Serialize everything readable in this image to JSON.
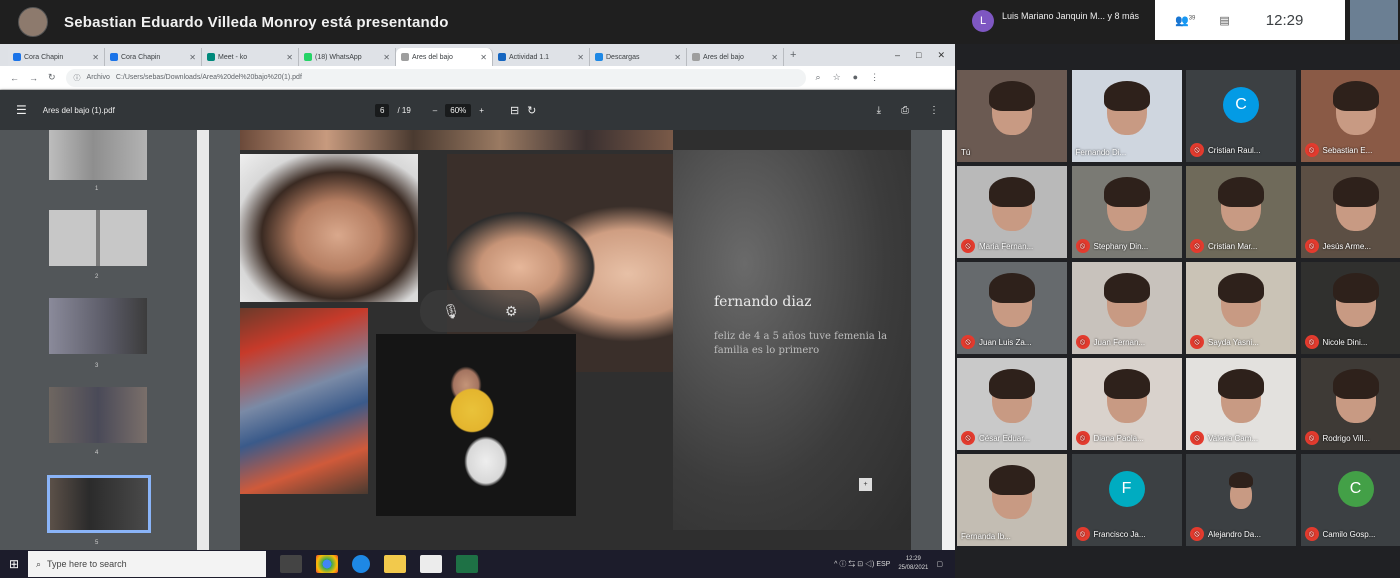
{
  "presenting": {
    "text": "Sebastian Eduardo Villeda Monroy está presentando"
  },
  "browser": {
    "tabs": [
      {
        "label": "Cora Chapin",
        "color": "#1a73e8"
      },
      {
        "label": "Cora Chapin",
        "color": "#1a73e8"
      },
      {
        "label": "Meet - ko",
        "color": "#00897b"
      },
      {
        "label": "(18) WhatsApp",
        "color": "#25d366"
      },
      {
        "label": "Ares del bajo",
        "color": "#9e9e9e",
        "active": true
      },
      {
        "label": "Actividad 1.1",
        "color": "#1565c0"
      },
      {
        "label": "Descargas",
        "color": "#1e88e5"
      },
      {
        "label": "Ares del bajo",
        "color": "#9e9e9e"
      }
    ],
    "new_tab": "+",
    "window_controls": [
      "–",
      "□",
      "✕"
    ],
    "url_protocol": "Archivo",
    "url": "C:/Users/sebas/Downloads/Area%20del%20bajo%20(1).pdf",
    "addr_icons": [
      "⌕",
      "☆",
      "●",
      "⋮"
    ]
  },
  "pdf": {
    "menu": "☰",
    "title": "Ares del bajo (1).pdf",
    "page": "6",
    "page_total": "/ 19",
    "zoom": "60%",
    "zoom_minus": "–",
    "zoom_plus": "+",
    "fit": "⊟",
    "rotate": "↻",
    "download": "⤓",
    "print": "⎙",
    "more": "⋮",
    "thumb_numbers": [
      "1",
      "2",
      "3",
      "4",
      "5"
    ],
    "slide": {
      "name": "fernando diaz",
      "desc": "feliz de 4 a 5 años tuve femenia la familia es lo primero",
      "box": "+"
    },
    "overlay": {
      "mic": "🎙",
      "settings": "⚙"
    }
  },
  "taskbar": {
    "start": "⊞",
    "search_icon": "⌕",
    "search_placeholder": "Type here to search",
    "tray": "^ ⓘ ⇆ ⊡ ◁) ESP",
    "time": "12:29",
    "date": "25/08/2021"
  },
  "meet": {
    "avatar_letter": "L",
    "who": "Luis Mariano Janquin M... y 8 más",
    "people_icon": "👥",
    "people_count": "39",
    "chat_icon": "▤",
    "time": "12:29",
    "participants": [
      {
        "name": "Tú",
        "type": "face",
        "bg": "#6b5a52",
        "muted": false
      },
      {
        "name": "Fernando Di...",
        "type": "face",
        "bg": "#cfd6df",
        "muted": false
      },
      {
        "name": "Cristian Raul...",
        "type": "avatar",
        "letter": "C",
        "color": "#039be5",
        "muted": true
      },
      {
        "name": "Sebastian E...",
        "type": "face",
        "bg": "#8a5a46",
        "muted": true
      },
      {
        "name": "Maria Fernan...",
        "type": "face",
        "bg": "#b9b9b9",
        "muted": true
      },
      {
        "name": "Stephany Din...",
        "type": "face",
        "bg": "#7a7a74",
        "muted": true
      },
      {
        "name": "Cristian Mar...",
        "type": "face",
        "bg": "#6f6a5a",
        "muted": true
      },
      {
        "name": "Jesús Arme...",
        "type": "face",
        "bg": "#5c4f44",
        "muted": true
      },
      {
        "name": "Juan Luis Za...",
        "type": "face",
        "bg": "#666a6d",
        "muted": true
      },
      {
        "name": "Juan Fernan...",
        "type": "face",
        "bg": "#c8c2bc",
        "muted": true
      },
      {
        "name": "Sayda Yasni...",
        "type": "face",
        "bg": "#cac3b6",
        "muted": true
      },
      {
        "name": "Nicole Dini...",
        "type": "face",
        "bg": "#30302e",
        "muted": true
      },
      {
        "name": "César Eduar...",
        "type": "face",
        "bg": "#c9c9c9",
        "muted": true
      },
      {
        "name": "Diana Paola...",
        "type": "face",
        "bg": "#d9d2cc",
        "muted": true
      },
      {
        "name": "Valeria Cam...",
        "type": "face",
        "bg": "#e3e1de",
        "muted": true
      },
      {
        "name": "Rodrigo Vill...",
        "type": "face",
        "bg": "#3e3a36",
        "muted": true
      },
      {
        "name": "Fernanda Ib...",
        "type": "face",
        "bg": "#c3bdb3",
        "muted": false
      },
      {
        "name": "Francisco Ja...",
        "type": "avatar",
        "letter": "F",
        "color": "#00acc1",
        "muted": true
      },
      {
        "name": "Alejandro Da...",
        "type": "face-small",
        "bg": "#3c4043",
        "muted": true
      },
      {
        "name": "Camilo Gosp...",
        "type": "avatar",
        "letter": "C",
        "color": "#43a047",
        "muted": true
      }
    ]
  }
}
